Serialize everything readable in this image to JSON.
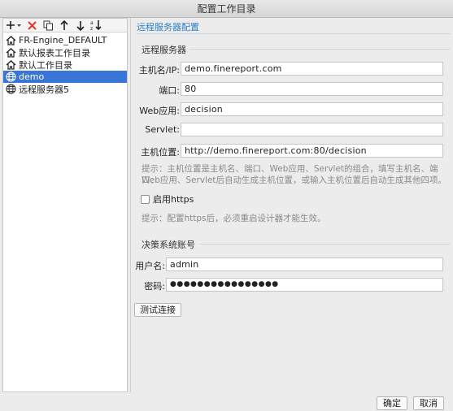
{
  "window": {
    "title": "配置工作目录"
  },
  "toolbar": {
    "add_icon": "plus-with-dropdown-icon",
    "delete_icon": "red-x-icon",
    "copy_icon": "copy-icon",
    "up_icon": "arrow-up-icon",
    "down_icon": "arrow-down-icon",
    "sort_icon": "sort-icon"
  },
  "tree": {
    "items": [
      {
        "label": "FR-Engine_DEFAULT",
        "icon": "home-icon",
        "selected": false
      },
      {
        "label": "默认报表工作目录",
        "icon": "home-icon",
        "selected": false
      },
      {
        "label": "默认工作目录",
        "icon": "home-icon",
        "selected": false
      },
      {
        "label": "demo",
        "icon": "globe-icon",
        "selected": true
      },
      {
        "label": "远程服务器5",
        "icon": "globe-icon",
        "selected": false
      }
    ]
  },
  "config": {
    "panel_title": "远程服务器配置",
    "server_section": "远程服务器",
    "host_label": "主机名/IP:",
    "host_value": "demo.finereport.com",
    "port_label": "端口:",
    "port_value": "80",
    "webapp_label": "Web应用:",
    "webapp_value": "decision",
    "servlet_label": "Servlet:",
    "servlet_value": "",
    "location_label": "主机位置:",
    "location_value": "http://demo.finereport.com:80/decision",
    "hint_line1": "提示：主机位置是主机名、端口、Web应用、Servlet的组合，填写主机名、端口、",
    "hint_line2": "Web应用、Servlet后自动生成主机位置，或输入主机位置后自动生成其他四项。",
    "https_label": "启用https",
    "https_checked": false,
    "https_hint": "提示：配置https后，必须重启设计器才能生效。",
    "account_section": "决策系统账号",
    "username_label": "用户名:",
    "username_value": "admin",
    "password_label": "密码:",
    "password_value": "●●●●●●●●●●●●●●●●",
    "test_button": "测试连接"
  },
  "footer": {
    "ok_button": "确定",
    "cancel_button": "取消"
  },
  "colors": {
    "accent": "#2c7fc4",
    "selection": "#3875d7",
    "delete_red": "#e0352b"
  }
}
